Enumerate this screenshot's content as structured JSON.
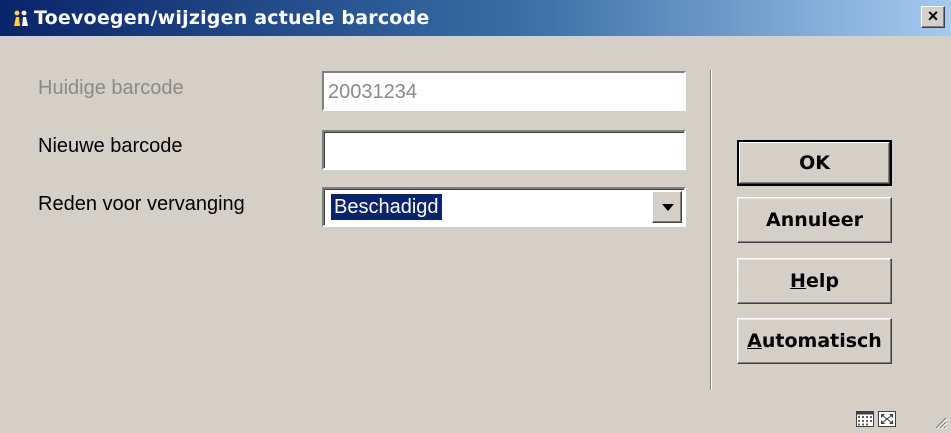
{
  "window": {
    "title": "Toevoegen/wijzigen actuele barcode",
    "close_label": "×"
  },
  "form": {
    "current_barcode_label": "Huidige barcode",
    "current_barcode_value": "20031234",
    "new_barcode_label": "Nieuwe barcode",
    "new_barcode_value": "",
    "reason_label": "Reden voor vervanging",
    "reason_value": "Beschadigd"
  },
  "buttons": {
    "ok": "OK",
    "cancel": "Annuleer",
    "help_first": "H",
    "help_rest": "elp",
    "auto_first": "A",
    "auto_rest": "utomatisch"
  },
  "colors": {
    "title_start": "#0a246a",
    "title_end": "#a6caf0",
    "face": "#d4d0c8",
    "selection": "#0a246a"
  },
  "icons": [
    "app-icon",
    "close-icon",
    "dropdown-arrow-icon",
    "calendar-icon",
    "maximize-icon",
    "resize-grip-icon"
  ]
}
